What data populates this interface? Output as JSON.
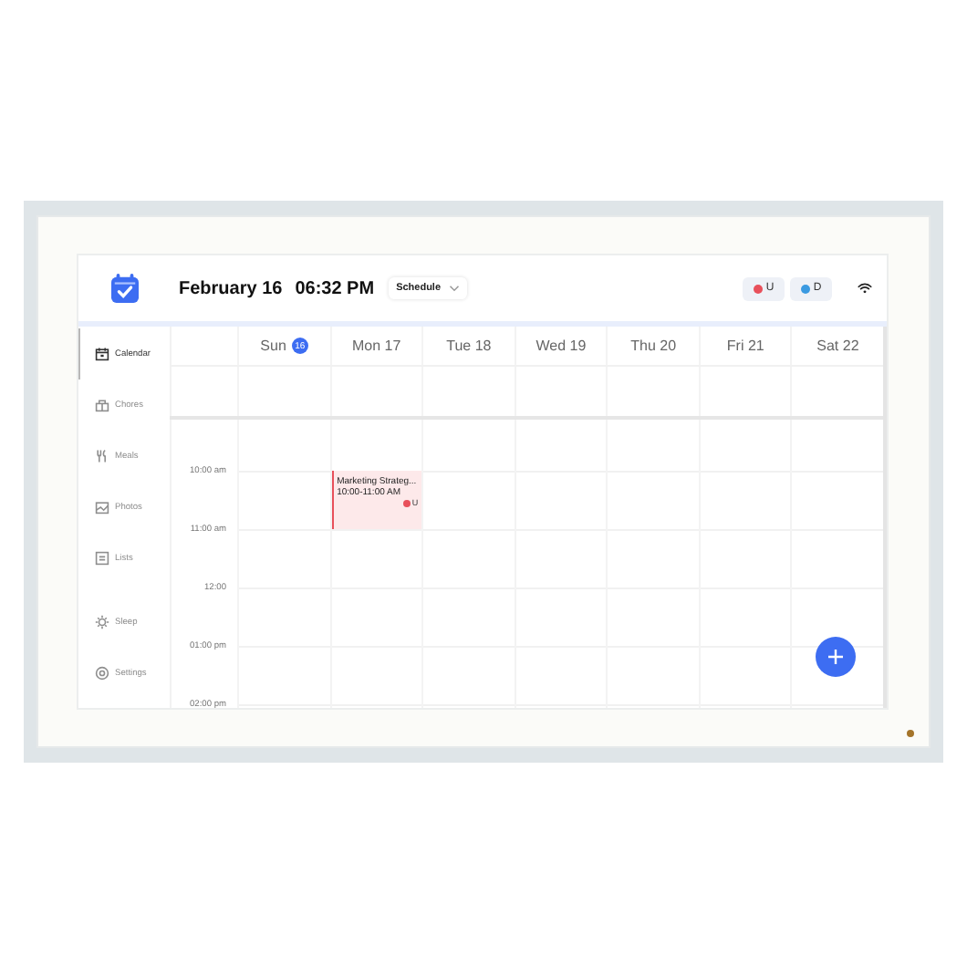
{
  "header": {
    "date": "February 16",
    "time": "06:32 PM",
    "view": "Schedule",
    "members": [
      {
        "initial": "U",
        "color": "#e8505b"
      },
      {
        "initial": "D",
        "color": "#3b9ae1"
      }
    ]
  },
  "sidebar": {
    "items": [
      {
        "label": "Calendar",
        "selected": true
      },
      {
        "label": "Chores",
        "selected": false
      },
      {
        "label": "Meals",
        "selected": false
      },
      {
        "label": "Photos",
        "selected": false
      },
      {
        "label": "Lists",
        "selected": false
      }
    ],
    "footer_items": [
      {
        "label": "Sleep",
        "selected": false
      },
      {
        "label": "Settings",
        "selected": false
      }
    ]
  },
  "days": [
    {
      "name": "Sun",
      "date": "16",
      "today": true
    },
    {
      "name": "Mon",
      "date": "17",
      "today": false,
      "events": [
        {
          "title": "Marketing Strateg...",
          "time": "10:00-11:00 AM",
          "member": "U",
          "color": "#e8505b"
        }
      ]
    },
    {
      "name": "Tue",
      "date": "18",
      "today": false
    },
    {
      "name": "Wed",
      "date": "19",
      "today": false
    },
    {
      "name": "Thu",
      "date": "20",
      "today": false
    },
    {
      "name": "Fri",
      "date": "21",
      "today": false
    },
    {
      "name": "Sat",
      "date": "22",
      "today": false
    }
  ],
  "time_slots": [
    "10:00 am",
    "11:00 am",
    "12:00",
    "01:00 pm",
    "02:00 pm"
  ]
}
